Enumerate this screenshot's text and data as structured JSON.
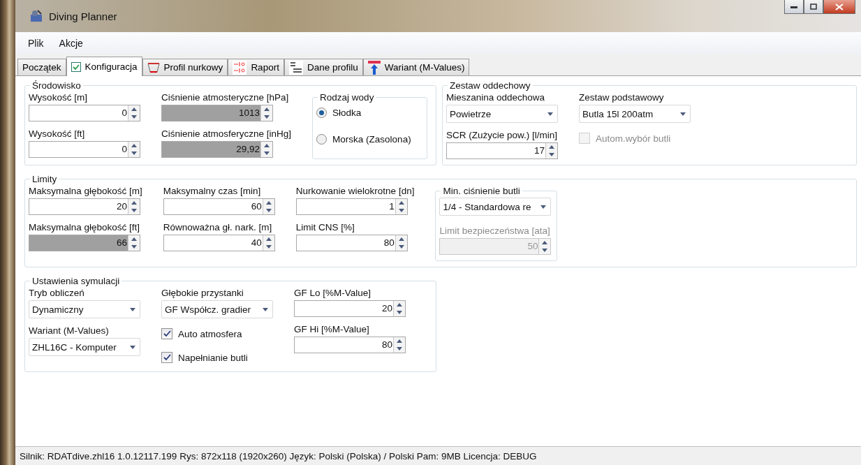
{
  "window": {
    "title": "Diving Planner"
  },
  "menu": [
    "Plik",
    "Akcje"
  ],
  "tabs": [
    {
      "label": "Początek",
      "selected": false
    },
    {
      "label": "Konfiguracja",
      "selected": true
    },
    {
      "label": "Profil nurkowy",
      "selected": false
    },
    {
      "label": "Raport",
      "selected": false
    },
    {
      "label": "Dane profilu",
      "selected": false
    },
    {
      "label": "Wariant (M-Values)",
      "selected": false
    }
  ],
  "rows": [
    [
      {
        "title": "Środowisko",
        "columns": [
          [
            {
              "kind": "spin",
              "label": "Wysokość [m]",
              "value": "0",
              "readonly": false,
              "disabled": false
            },
            {
              "kind": "spin",
              "label": "Wysokość [ft]",
              "value": "0",
              "readonly": false,
              "disabled": false
            }
          ],
          [
            {
              "kind": "spin",
              "label": "Ciśnienie atmosteryczne [hPa]",
              "value": "1013",
              "readonly": true,
              "disabled": false
            },
            {
              "kind": "spin",
              "label": "Ciśnienie atmosferyczne [inHg]",
              "value": "29,92",
              "readonly": true,
              "disabled": false
            }
          ]
        ],
        "subgroup": {
          "title": "Rodzaj wody",
          "fields": [
            {
              "kind": "radio",
              "label": "Słodka",
              "selected": true
            },
            {
              "kind": "radio",
              "label": "Morska (Zasolona)",
              "selected": false
            }
          ]
        }
      },
      {
        "title": "Zestaw oddechowy",
        "columns": [
          [
            {
              "kind": "combo",
              "label": "Mieszanina oddechowa",
              "value": "Powietrze"
            },
            {
              "kind": "spin",
              "label": "SCR (Zużycie pow.) [l/min]",
              "value": "17",
              "readonly": false,
              "disabled": false
            }
          ],
          [
            {
              "kind": "combo",
              "label": "Zestaw podstawowy",
              "value": "Butla 15l 200atm"
            },
            {
              "kind": "checkbox",
              "label": "Autom.wybór butli",
              "checked": false,
              "disabled": true
            }
          ]
        ]
      }
    ],
    [
      {
        "title": "Limity",
        "columns": [
          [
            {
              "kind": "spin",
              "label": "Maksymalna głębokość [m]",
              "value": "20",
              "readonly": false,
              "disabled": false
            },
            {
              "kind": "spin",
              "label": "Maksymalna głębokość [ft]",
              "value": "66",
              "readonly": true,
              "disabled": false
            }
          ],
          [
            {
              "kind": "spin",
              "label": "Maksymalny czas [min]",
              "value": "60",
              "readonly": false,
              "disabled": false
            },
            {
              "kind": "spin",
              "label": "Równoważna gł. nark. [m]",
              "value": "40",
              "readonly": false,
              "disabled": false
            }
          ],
          [
            {
              "kind": "spin",
              "label": "Nurkowanie wielokrotne [dn]",
              "value": "1",
              "readonly": false,
              "disabled": false
            },
            {
              "kind": "spin",
              "label": "Limit CNS [%]",
              "value": "80",
              "readonly": false,
              "disabled": false
            }
          ]
        ],
        "subgroup": {
          "title": "Min. ciśnienie butli",
          "fields": [
            {
              "kind": "combo",
              "value": "1/4 - Standardowa re"
            },
            {
              "kind": "spin",
              "label": "Limit bezpieczeństwa [ata]",
              "value": "50",
              "readonly": false,
              "disabled": true
            }
          ]
        }
      }
    ],
    [
      {
        "title": "Ustawienia symulacji",
        "columns": [
          [
            {
              "kind": "combo",
              "label": "Tryb obliczeń",
              "value": "Dynamiczny"
            },
            {
              "kind": "combo",
              "label": "Wariant (M-Values)",
              "value": "ZHL16C - Komputer"
            }
          ],
          [
            {
              "kind": "combo",
              "label": "Głębokie przystanki",
              "value": "GF Współcz. gradier"
            },
            {
              "kind": "checkbox",
              "label": "Auto atmosfera",
              "checked": true,
              "disabled": false
            },
            {
              "kind": "checkbox",
              "label": "Napełnianie butli",
              "checked": true,
              "disabled": false
            }
          ],
          [
            {
              "kind": "spin",
              "label": "GF Lo [%M-Value]",
              "value": "20",
              "readonly": false,
              "disabled": false
            },
            {
              "kind": "spin",
              "label": "GF Hi [%M-Value]",
              "value": "80",
              "readonly": false,
              "disabled": false
            }
          ]
        ]
      }
    ]
  ],
  "status_bar": "Silnik: RDATdive.zhl16 1.0.12117.199  Rys: 872x118 (1920x260)  Język: Polski (Polska) / Polski  Pam: 9MB  Licencja: DEBUG"
}
